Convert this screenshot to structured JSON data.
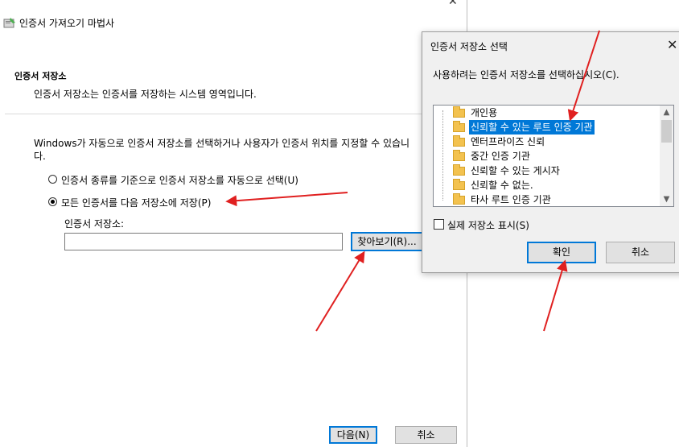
{
  "wizard": {
    "title": "인증서 가져오기 마법사",
    "section_heading": "인증서 저장소",
    "section_desc": "인증서 저장소는 인증서를 저장하는 시스템 영역입니다.",
    "intro": "Windows가 자동으로 인증서 저장소를 선택하거나 사용자가 인증서 위치를 지정할 수 있습니다.",
    "option_auto": "인증서 종류를 기준으로 인증서 저장소를 자동으로 선택(U)",
    "option_manual": "모든 인증서를 다음 저장소에 저장(P)",
    "selected_option": "manual",
    "store_label": "인증서 저장소:",
    "store_value": "",
    "browse_button": "찾아보기(R)...",
    "next_button": "다음(N)",
    "cancel_button": "취소"
  },
  "dialog": {
    "title": "인증서 저장소 선택",
    "instruction": "사용하려는 인증서 저장소를 선택하십시오(C).",
    "stores": [
      "개인용",
      "신뢰할 수 있는 루트 인증 기관",
      "엔터프라이즈 신뢰",
      "중간 인증 기관",
      "신뢰할 수 있는 게시자",
      "신뢰할 수 없는.",
      "타사 루트 인증 기관"
    ],
    "selected_store": "신뢰할 수 있는 루트 인증 기관",
    "show_physical_label": "실제 저장소 표시(S)",
    "show_physical_checked": false,
    "ok_button": "확인",
    "cancel_button": "취소"
  },
  "colors": {
    "selection": "#0078d7",
    "annotation_arrow": "#e02020",
    "folder": "#f3c24f"
  }
}
